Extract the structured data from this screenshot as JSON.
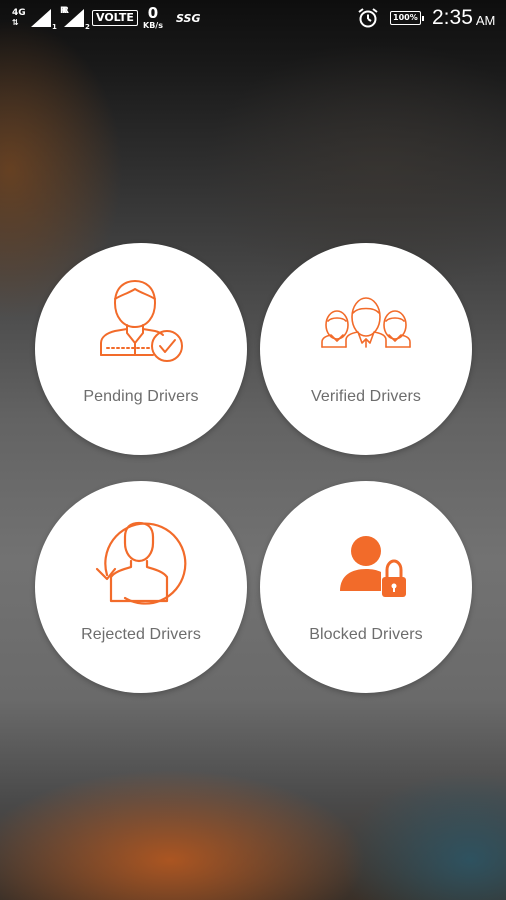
{
  "status_bar": {
    "sim1_network": "4G",
    "sim1_sub": "R",
    "sim1_index": "1",
    "sim2_sub": "R",
    "sim2_index": "2",
    "volte": "VOLTE",
    "data_speed_value": "0",
    "data_speed_unit": "KB/s",
    "carrier_badge": "SSG",
    "battery": "100%",
    "time": "2:35",
    "ampm": "AM"
  },
  "menu": {
    "pending": {
      "label": "Pending Drivers",
      "icon": "user-check-icon"
    },
    "verified": {
      "label": "Verified Drivers",
      "icon": "user-group-icon"
    },
    "rejected": {
      "label": "Rejected Drivers",
      "icon": "user-rotate-icon"
    },
    "blocked": {
      "label": "Blocked Drivers",
      "icon": "user-lock-icon"
    }
  },
  "colors": {
    "accent": "#F26B2A",
    "tile_background": "#FFFFFF",
    "label_text": "#6D6D6D"
  }
}
